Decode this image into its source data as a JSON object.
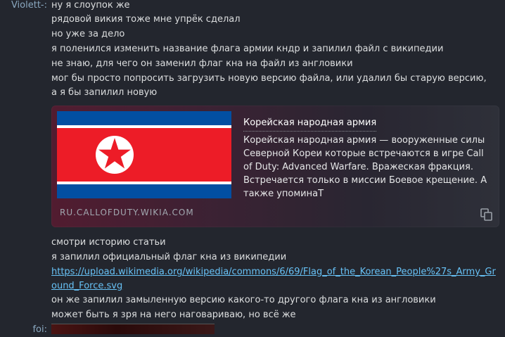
{
  "messages": {
    "author1": "Violett-:",
    "lines1": [
      "ну я слоупок же",
      "рядовой викия тоже мне упрёк сделал",
      "но уже за дело",
      "я поленился изменить название флага армии кндр и запилил файл с википедии",
      "не знаю, для чего он заменил флаг кна на файл из англовики",
      "мог бы просто попросить загрузить новую версию файла, или удалил бы старую версию, а я бы запилил новую"
    ],
    "lines2": [
      "смотри историю статьи",
      "я запилил официальный флаг кна из википедии",
      "https://upload.wikimedia.org/wikipedia/commons/6/69/Flag_of_the_Korean_People%27s_Army_Ground_Force.svg",
      "он же запилил замыленную версию какого-то другого флага кна из англовики",
      "может быть я зря на него наговариваю, но всё же"
    ],
    "author2": "foi:"
  },
  "embed": {
    "title": "Корейская народная армия",
    "description": "Корейская народная армия — вооруженные силы Северной Кореи которые встречаются в игре Call of Duty: Advanced Warfare. Вражеская фракция. Встречается только в миссии Боевое крещение. А также упоминаТ",
    "domain": "RU.CALLOFDUTY.WIKIA.COM",
    "thumbnail_icon": "north-korea-flag",
    "copy_icon": "copy-icon"
  },
  "colors": {
    "background": "#23262e",
    "text": "#dcdedf",
    "author": "#8aa8c0",
    "link": "#67c1f5",
    "flag_blue": "#024fa2",
    "flag_red": "#ed1c27"
  }
}
